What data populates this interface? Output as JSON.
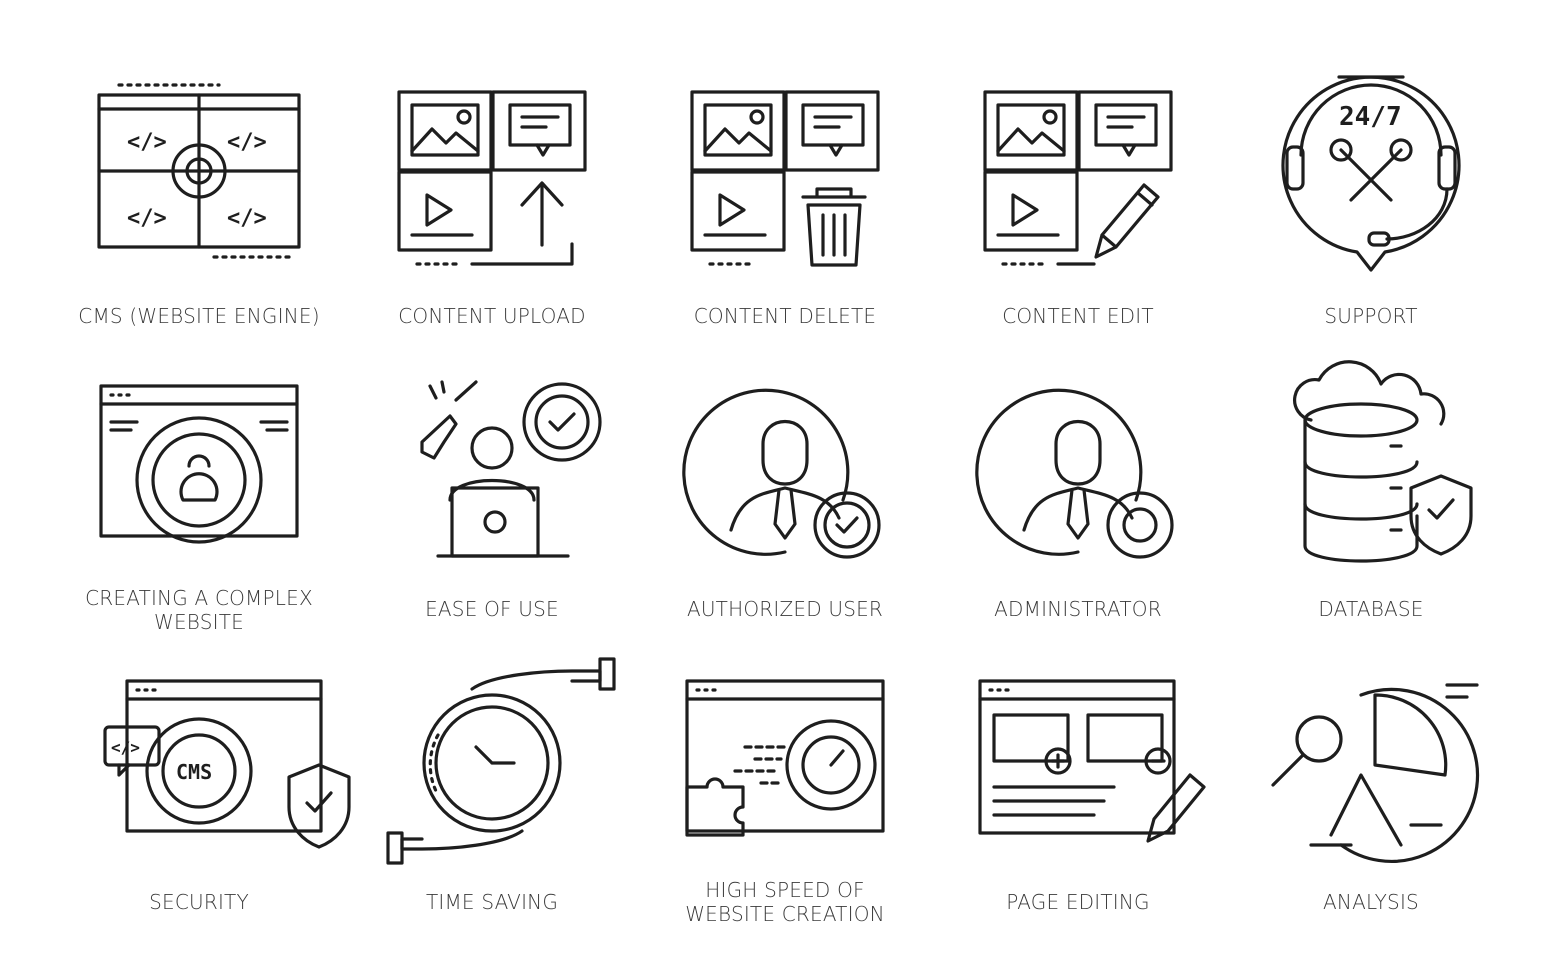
{
  "icons": [
    {
      "id": "cms",
      "label_lines": [
        "CMS (WEBSITE ENGINE)"
      ],
      "glyph": "</>"
    },
    {
      "id": "content-upload",
      "label_lines": [
        "CONTENT UPLOAD"
      ]
    },
    {
      "id": "content-delete",
      "label_lines": [
        "CONTENT DELETE"
      ]
    },
    {
      "id": "content-edit",
      "label_lines": [
        "CONTENT EDIT"
      ]
    },
    {
      "id": "support",
      "label_lines": [
        "SUPPORT"
      ],
      "glyph": "24/7"
    },
    {
      "id": "complex-website",
      "label_lines": [
        "CREATING A COMPLEX",
        "WEBSITE"
      ]
    },
    {
      "id": "ease-of-use",
      "label_lines": [
        "EASE OF USE"
      ]
    },
    {
      "id": "authorized-user",
      "label_lines": [
        "AUTHORIZED USER"
      ]
    },
    {
      "id": "administrator",
      "label_lines": [
        "ADMINISTRATOR"
      ]
    },
    {
      "id": "database",
      "label_lines": [
        "DATABASE"
      ]
    },
    {
      "id": "security",
      "label_lines": [
        "SECURITY"
      ],
      "glyph": "CMS",
      "code_glyph": "</>"
    },
    {
      "id": "time-saving",
      "label_lines": [
        "TIME SAVING"
      ]
    },
    {
      "id": "high-speed",
      "label_lines": [
        "HIGH SPEED OF",
        "WEBSITE CREATION"
      ]
    },
    {
      "id": "page-editing",
      "label_lines": [
        "PAGE EDITING"
      ]
    },
    {
      "id": "analysis",
      "label_lines": [
        "ANALYSIS"
      ]
    }
  ],
  "colors": {
    "stroke": "#1e1e1e",
    "label": "#3a3a3a",
    "background": "#ffffff"
  }
}
